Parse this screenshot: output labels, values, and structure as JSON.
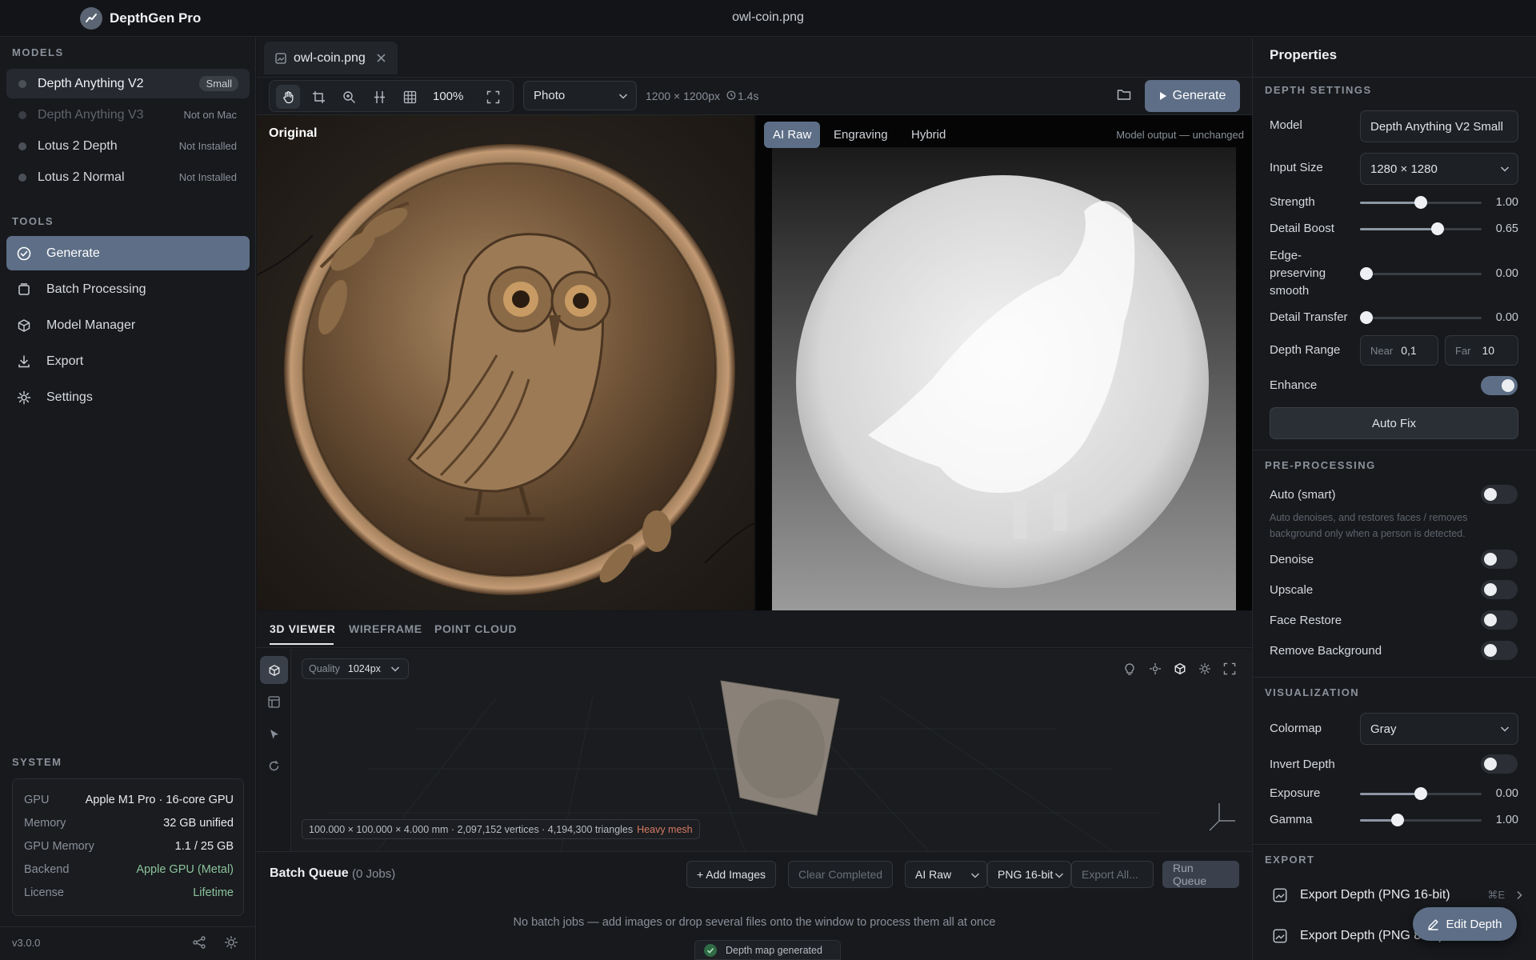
{
  "app": {
    "name": "DepthGen Pro",
    "window_title": "owl-coin.png"
  },
  "sidebar": {
    "models_header": "MODELS",
    "models": [
      {
        "name": "Depth Anything V2",
        "tag": "Small"
      },
      {
        "name": "Depth Anything V3",
        "tag": "Not on Mac"
      },
      {
        "name": "Lotus 2 Depth",
        "tag": "Not Installed"
      },
      {
        "name": "Lotus 2 Normal",
        "tag": "Not Installed"
      }
    ],
    "tools_header": "TOOLS",
    "tools": [
      {
        "label": "Generate",
        "icon": "check-circle-icon"
      },
      {
        "label": "Batch Processing",
        "icon": "layers-icon"
      },
      {
        "label": "Model Manager",
        "icon": "cube-icon"
      },
      {
        "label": "Export",
        "icon": "download-icon"
      },
      {
        "label": "Settings",
        "icon": "gear-icon"
      }
    ],
    "system_header": "SYSTEM",
    "system": [
      {
        "k": "GPU",
        "v": "Apple M1 Pro · 16-core GPU"
      },
      {
        "k": "Memory",
        "v": "32 GB unified"
      },
      {
        "k": "GPU Memory",
        "v": "1.1 / 25 GB"
      },
      {
        "k": "Backend",
        "v": "Apple GPU (Metal)"
      },
      {
        "k": "License",
        "v": "Lifetime"
      }
    ],
    "version": "v3.0.0"
  },
  "editor": {
    "tab": "owl-coin.png",
    "zoom": "100%",
    "mode": "Photo",
    "dimensions": "1200 × 1200px",
    "time": "1.4s",
    "generate_label": "Generate"
  },
  "panes": {
    "left_label": "Original",
    "right_modes": [
      "AI Raw",
      "Engraving",
      "Hybrid"
    ],
    "right_status": "Model output — unchanged"
  },
  "viewer": {
    "tabs": [
      "3D VIEWER",
      "WIREFRAME",
      "POINT CLOUD"
    ],
    "quality_label": "Quality",
    "quality_value": "1024px",
    "mesh_info": "100.000 × 100.000 × 4.000 mm · 2,097,152 vertices · 4,194,300 triangles",
    "mesh_warning": "Heavy mesh"
  },
  "batch": {
    "title": "Batch Queue",
    "count": "(0 Jobs)",
    "add_images": "+ Add Images",
    "clear_completed": "Clear Completed",
    "source": "AI Raw",
    "format": "PNG 16-bit",
    "export_all": "Export All...",
    "run_queue": "Run Queue",
    "empty_msg": "No batch jobs — add images or drop several files onto the window to process them all at once",
    "toast": "Depth map generated"
  },
  "props": {
    "title": "Properties",
    "depth_header": "DEPTH SETTINGS",
    "model_label": "Model",
    "model_value": "Depth Anything V2 Small",
    "input_size_label": "Input Size",
    "input_size_value": "1280 × 1280",
    "sliders": [
      {
        "label": "Strength",
        "value": "1.00",
        "level": 0.5
      },
      {
        "label": "Detail Boost",
        "value": "0.65",
        "level": 0.64
      },
      {
        "label": "Edge-preserving smooth",
        "value": "0.00",
        "level": 0.05
      },
      {
        "label": "Detail Transfer",
        "value": "0.00",
        "level": 0.05
      }
    ],
    "depth_range_label": "Depth Range",
    "near_label": "Near",
    "near_value": "0,1",
    "far_label": "Far",
    "far_value": "10",
    "enhance_label": "Enhance",
    "auto_fix": "Auto Fix",
    "pre_header": "PRE-PROCESSING",
    "auto_smart": "Auto (smart)",
    "auto_desc": "Auto denoises, and restores faces / removes background only when a person is detected.",
    "pre_toggles": [
      "Denoise",
      "Upscale",
      "Face Restore",
      "Remove Background"
    ],
    "vis_header": "VISUALIZATION",
    "colormap_label": "Colormap",
    "colormap_value": "Gray",
    "invert_label": "Invert Depth",
    "exposure": {
      "label": "Exposure",
      "value": "0.00",
      "level": 0.5
    },
    "gamma": {
      "label": "Gamma",
      "value": "1.00",
      "level": 0.31
    },
    "export_header": "EXPORT",
    "export_items": [
      {
        "label": "Export Depth (PNG 16-bit)",
        "shortcut": "⌘E"
      },
      {
        "label": "Export Depth (PNG 8-bit)",
        "shortcut": ""
      }
    ],
    "edit_depth": "Edit Depth"
  },
  "colors": {
    "accent": "#5d6e86",
    "warning": "#d77a63",
    "success": "#8bc39a"
  }
}
